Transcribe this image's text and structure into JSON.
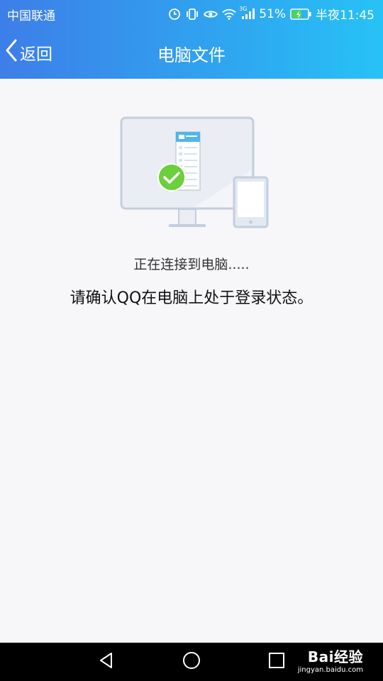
{
  "statusbar": {
    "carrier": "中国联通",
    "network_type": "3G",
    "battery_percent": "51%",
    "time": "半夜11:45"
  },
  "navbar": {
    "back_label": "返回",
    "title": "电脑文件"
  },
  "main": {
    "status_text": "正在连接到电脑.....",
    "instruction": "请确认QQ在电脑上处于登录状态。"
  },
  "watermark": {
    "brand": "Bai经验",
    "url": "jingyan.baidu.com"
  },
  "colors": {
    "header_gradient_start": "#3d7ee8",
    "header_gradient_end": "#27c2f6",
    "check_green": "#6ccf3c",
    "background": "#f7f7fa"
  },
  "icons": {
    "statusbar": [
      "alarm-icon",
      "vibrate-icon",
      "eye-icon",
      "wifi-icon",
      "signal-icon",
      "battery-icon"
    ],
    "navbar": [
      "chevron-left-icon"
    ],
    "bottom_nav": [
      "back-triangle-icon",
      "home-circle-icon",
      "recents-square-icon"
    ]
  }
}
